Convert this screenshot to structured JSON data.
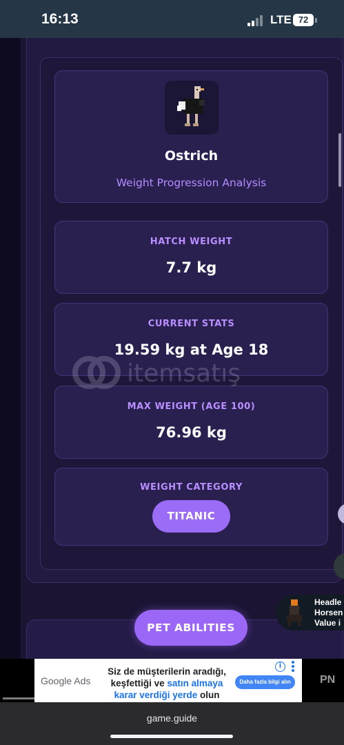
{
  "status_bar": {
    "time": "16:13",
    "network": "LTE",
    "battery": "72"
  },
  "pet": {
    "name": "Ostrich",
    "subtitle": "Weight Progression Analysis"
  },
  "stats": [
    {
      "label": "HATCH WEIGHT",
      "value": "7.7 kg"
    },
    {
      "label": "CURRENT STATS",
      "value": "19.59 kg at Age 18"
    },
    {
      "label": "MAX WEIGHT (AGE 100)",
      "value": "76.96 kg"
    }
  ],
  "category": {
    "label": "WEIGHT CATEGORY",
    "value": "TITANIC"
  },
  "watermark": "itemsatış",
  "abilities_button": "PET ABILITIES",
  "recommendation": {
    "line1": "Headle",
    "line2": "Horsen",
    "line3": "Value i"
  },
  "ad": {
    "brand": "Google Ads",
    "line1": "Siz de müşterilerin aradığı,",
    "line2a": "keşfettiği ve ",
    "line2b": "satın almaya",
    "line3a": "karar verdiği yerde ",
    "line3b": "olun",
    "cta": "Daha fazla bilgi alın",
    "right_text": "PN"
  },
  "browser": {
    "url": "game.guide"
  },
  "colors": {
    "accent": "#9b67f7",
    "label": "#b98fff",
    "card": "#2a2050",
    "background": "#1b1433"
  }
}
